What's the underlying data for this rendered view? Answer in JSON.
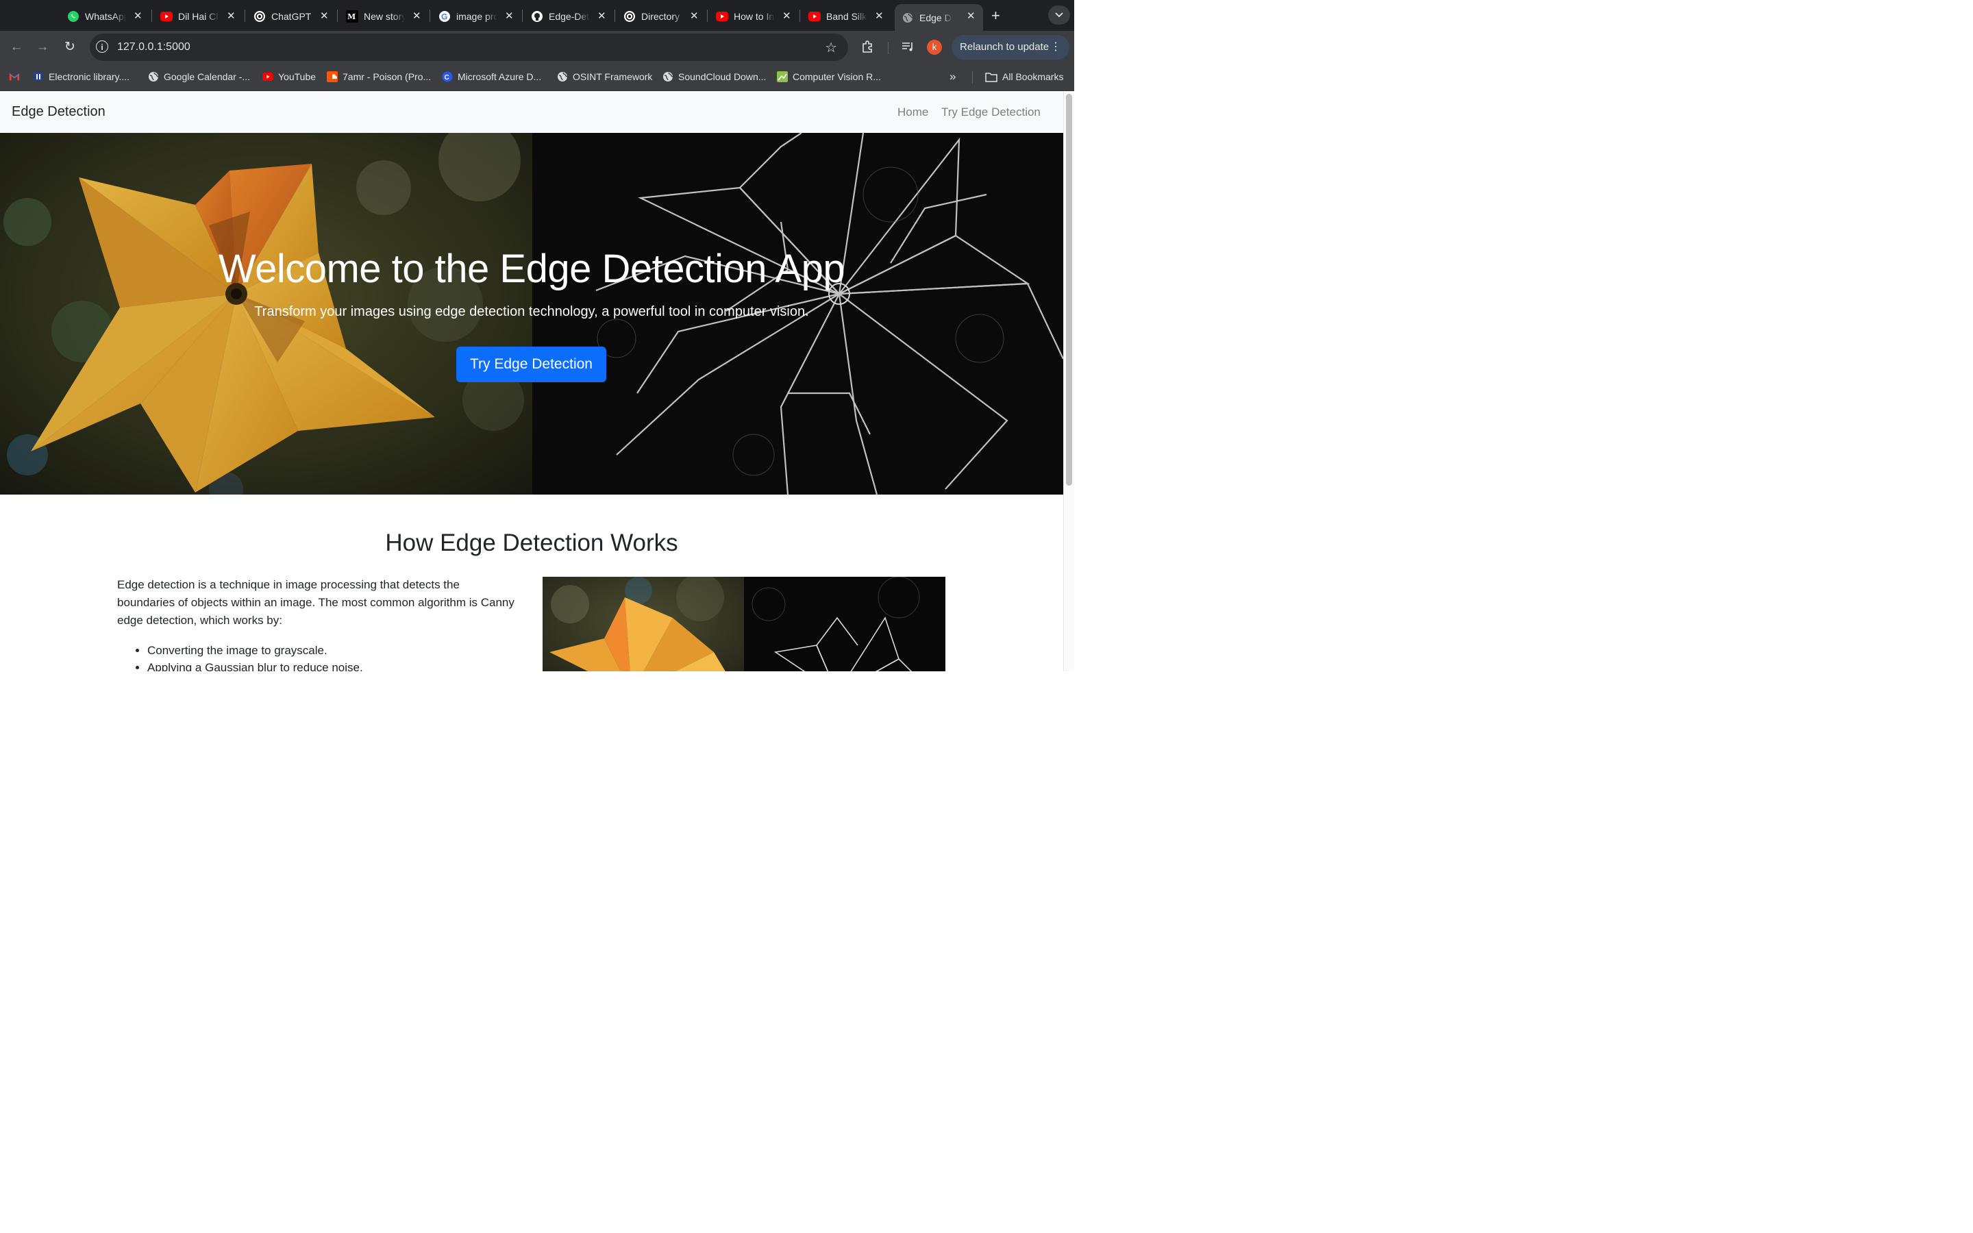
{
  "browser": {
    "tabs": [
      {
        "title": "WhatsApp",
        "icon": "whatsapp-icon"
      },
      {
        "title": "Dil Hai Chhota Sa",
        "icon": "youtube-icon"
      },
      {
        "title": "ChatGPT",
        "icon": "openai-icon"
      },
      {
        "title": "New story",
        "icon": "medium-icon"
      },
      {
        "title": "image processing",
        "icon": "google-icon"
      },
      {
        "title": "Edge-Detection",
        "icon": "github-icon"
      },
      {
        "title": "Directory",
        "icon": "openai-icon"
      },
      {
        "title": "How to Install",
        "icon": "youtube-icon"
      },
      {
        "title": "Band Silk",
        "icon": "youtube-icon"
      },
      {
        "title": "Edge Detection",
        "icon": "globe-icon",
        "active": true
      }
    ],
    "url": "127.0.0.1:5000",
    "profile_initial": "k",
    "relaunch_label": "Relaunch to update",
    "bookmarks": [
      {
        "label": "",
        "icon": "gmail-icon"
      },
      {
        "label": "Electronic library....",
        "icon": "library-icon"
      },
      {
        "label": "Google Calendar -...",
        "icon": "globe-icon"
      },
      {
        "label": "YouTube",
        "icon": "youtube-icon"
      },
      {
        "label": "7amr - Poison (Pro...",
        "icon": "soundcloud-icon"
      },
      {
        "label": "Microsoft Azure D...",
        "icon": "azure-icon"
      },
      {
        "label": "OSINT Framework",
        "icon": "globe-icon"
      },
      {
        "label": "SoundCloud Down...",
        "icon": "globe-icon"
      },
      {
        "label": "Computer Vision R...",
        "icon": "cv-icon"
      }
    ],
    "all_bookmarks_label": "All Bookmarks"
  },
  "site": {
    "brand": "Edge Detection",
    "nav": [
      "Home",
      "Try Edge Detection"
    ]
  },
  "hero": {
    "title": "Welcome to the Edge Detection App",
    "subtitle": "Transform your images using edge detection technology, a powerful tool in computer vision.",
    "button": "Try Edge Detection"
  },
  "how": {
    "title": "How Edge Detection Works",
    "paragraph": "Edge detection is a technique in image processing that detects the boundaries of objects within an image. The most common algorithm is Canny edge detection, which works by:",
    "steps": [
      "Converting the image to grayscale.",
      "Applying a Gaussian blur to reduce noise."
    ]
  },
  "colors": {
    "primary": "#0d6efd",
    "chrome_dark": "#1f2023",
    "chrome_toolbar": "#3c3d41"
  }
}
